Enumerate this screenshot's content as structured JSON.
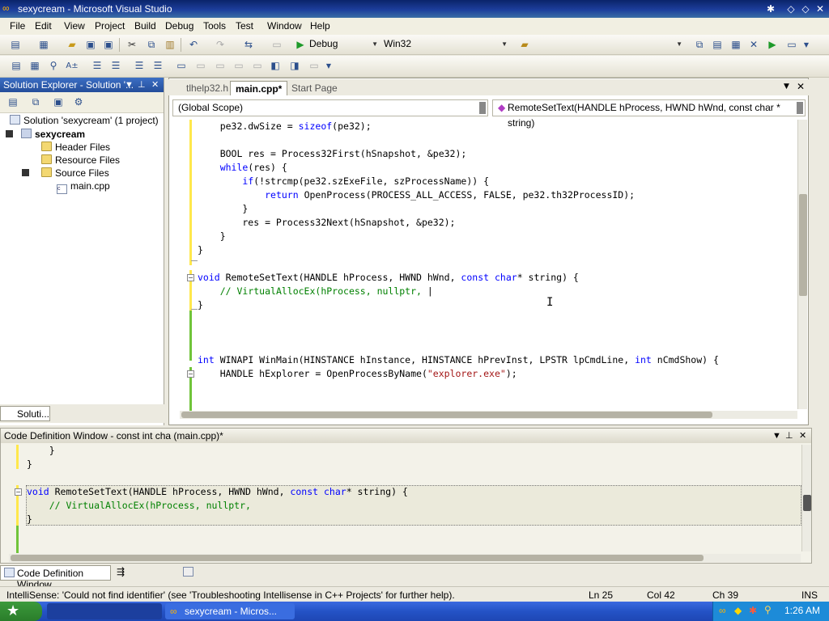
{
  "window": {
    "title": "sexycream - Microsoft Visual Studio"
  },
  "menu": [
    "File",
    "Edit",
    "View",
    "Project",
    "Build",
    "Debug",
    "Tools",
    "Test",
    "Window",
    "Help"
  ],
  "toolbar": {
    "config": "Debug",
    "platform": "Win32"
  },
  "solution_explorer": {
    "title": "Solution Explorer - Solution '...",
    "solution": "Solution 'sexycream' (1 project)",
    "project": "sexycream",
    "items": [
      "Header Files",
      "Resource Files",
      "Source Files",
      "main.cpp"
    ],
    "bottom_tab": "Soluti..."
  },
  "editor": {
    "tabs": [
      "tlhelp32.h",
      "main.cpp*",
      "Start Page"
    ],
    "scope": "(Global Scope)",
    "member": "RemoteSetText(HANDLE hProcess, HWND hWnd, const char * string)"
  },
  "code_definition": {
    "title": "Code Definition Window - const int cha (main.cpp)*",
    "bottom_tab": "Code Definition Window"
  },
  "status": {
    "message": "IntelliSense: 'Could not find identifier'   (see 'Troubleshooting Intellisense in C++ Projects' for further help).",
    "ln": "Ln 25",
    "col": "Col 42",
    "ch": "Ch 39",
    "mode": "INS"
  },
  "taskbar": {
    "task": "sexycream - Micros...",
    "clock": "1:26 AM"
  }
}
